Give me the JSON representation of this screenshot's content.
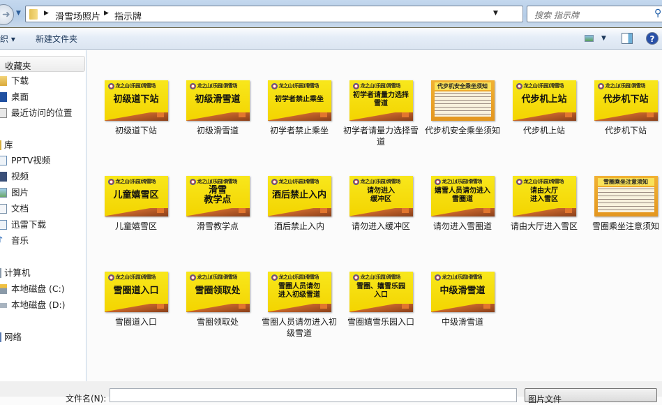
{
  "address": {
    "crumbs": [
      "滑雪场照片",
      "指示牌"
    ],
    "search_placeholder": "搜索 指示牌"
  },
  "toolbar": {
    "organize": "组织",
    "new_folder": "新建文件夹"
  },
  "sidebar": {
    "favorites": "收藏夹",
    "fav_items": [
      "下载",
      "桌面",
      "最近访问的位置"
    ],
    "libraries": "库",
    "lib_items": [
      "PPTV视频",
      "视频",
      "图片",
      "文档",
      "迅雷下载",
      "音乐"
    ],
    "computer": "计算机",
    "drives": [
      "本地磁盘 (C:)",
      "本地磁盘 (D:)"
    ],
    "network": "网络"
  },
  "logo_text": "龙之山(乐园)滑雪场",
  "files": [
    {
      "name": "初级道下站",
      "sign": "初级道下站",
      "type": "sign"
    },
    {
      "name": "初级滑雪道",
      "sign": "初级滑雪道",
      "type": "sign"
    },
    {
      "name": "初学者禁止乘坐",
      "sign": "初学者禁止乘坐",
      "type": "sign"
    },
    {
      "name": "初学者请量力选择雪道",
      "sign": "初学者请量力选择雪道",
      "type": "sign"
    },
    {
      "name": "代步机安全乘坐须知",
      "sign": "代步机安全乘坐须知",
      "type": "notice"
    },
    {
      "name": "代步机上站",
      "sign": "代步机上站",
      "type": "sign"
    },
    {
      "name": "代步机下站",
      "sign": "代步机下站",
      "type": "sign"
    },
    {
      "name": "儿童嬉雪区",
      "sign": "儿童嬉雪区",
      "type": "sign"
    },
    {
      "name": "滑雪教学点",
      "sign": "滑雪 教学点",
      "type": "sign"
    },
    {
      "name": "酒后禁止入内",
      "sign": "酒后禁止入内",
      "type": "sign"
    },
    {
      "name": "请勿进入缓冲区",
      "sign": "请勿进入 缓冲区",
      "type": "sign"
    },
    {
      "name": "请勿进入雪圈道",
      "sign": "嬉雪人员请勿进入 雪圈道",
      "type": "sign"
    },
    {
      "name": "请由大厅进入雪区",
      "sign": "请由大厅 进入雪区",
      "type": "sign"
    },
    {
      "name": "雪圈乘坐注意须知",
      "sign": "雪圈乘坐注意须知",
      "type": "notice"
    },
    {
      "name": "雪圈道入口",
      "sign": "雪圈道入口",
      "type": "sign"
    },
    {
      "name": "雪圈领取处",
      "sign": "雪圈领取处",
      "type": "sign"
    },
    {
      "name": "雪圈人员请勿进入初级雪道",
      "sign": "雪圈人员请勿 进入初级雪道",
      "type": "sign"
    },
    {
      "name": "雪圈嬉雪乐园入口",
      "sign": "雪圈、嬉雪乐园 入口",
      "type": "sign"
    },
    {
      "name": "中级滑雪道",
      "sign": "中级滑雪道",
      "type": "sign"
    }
  ],
  "footer": {
    "filename_label": "文件名(N):",
    "filename_value": "",
    "filetype": "图片文件"
  }
}
